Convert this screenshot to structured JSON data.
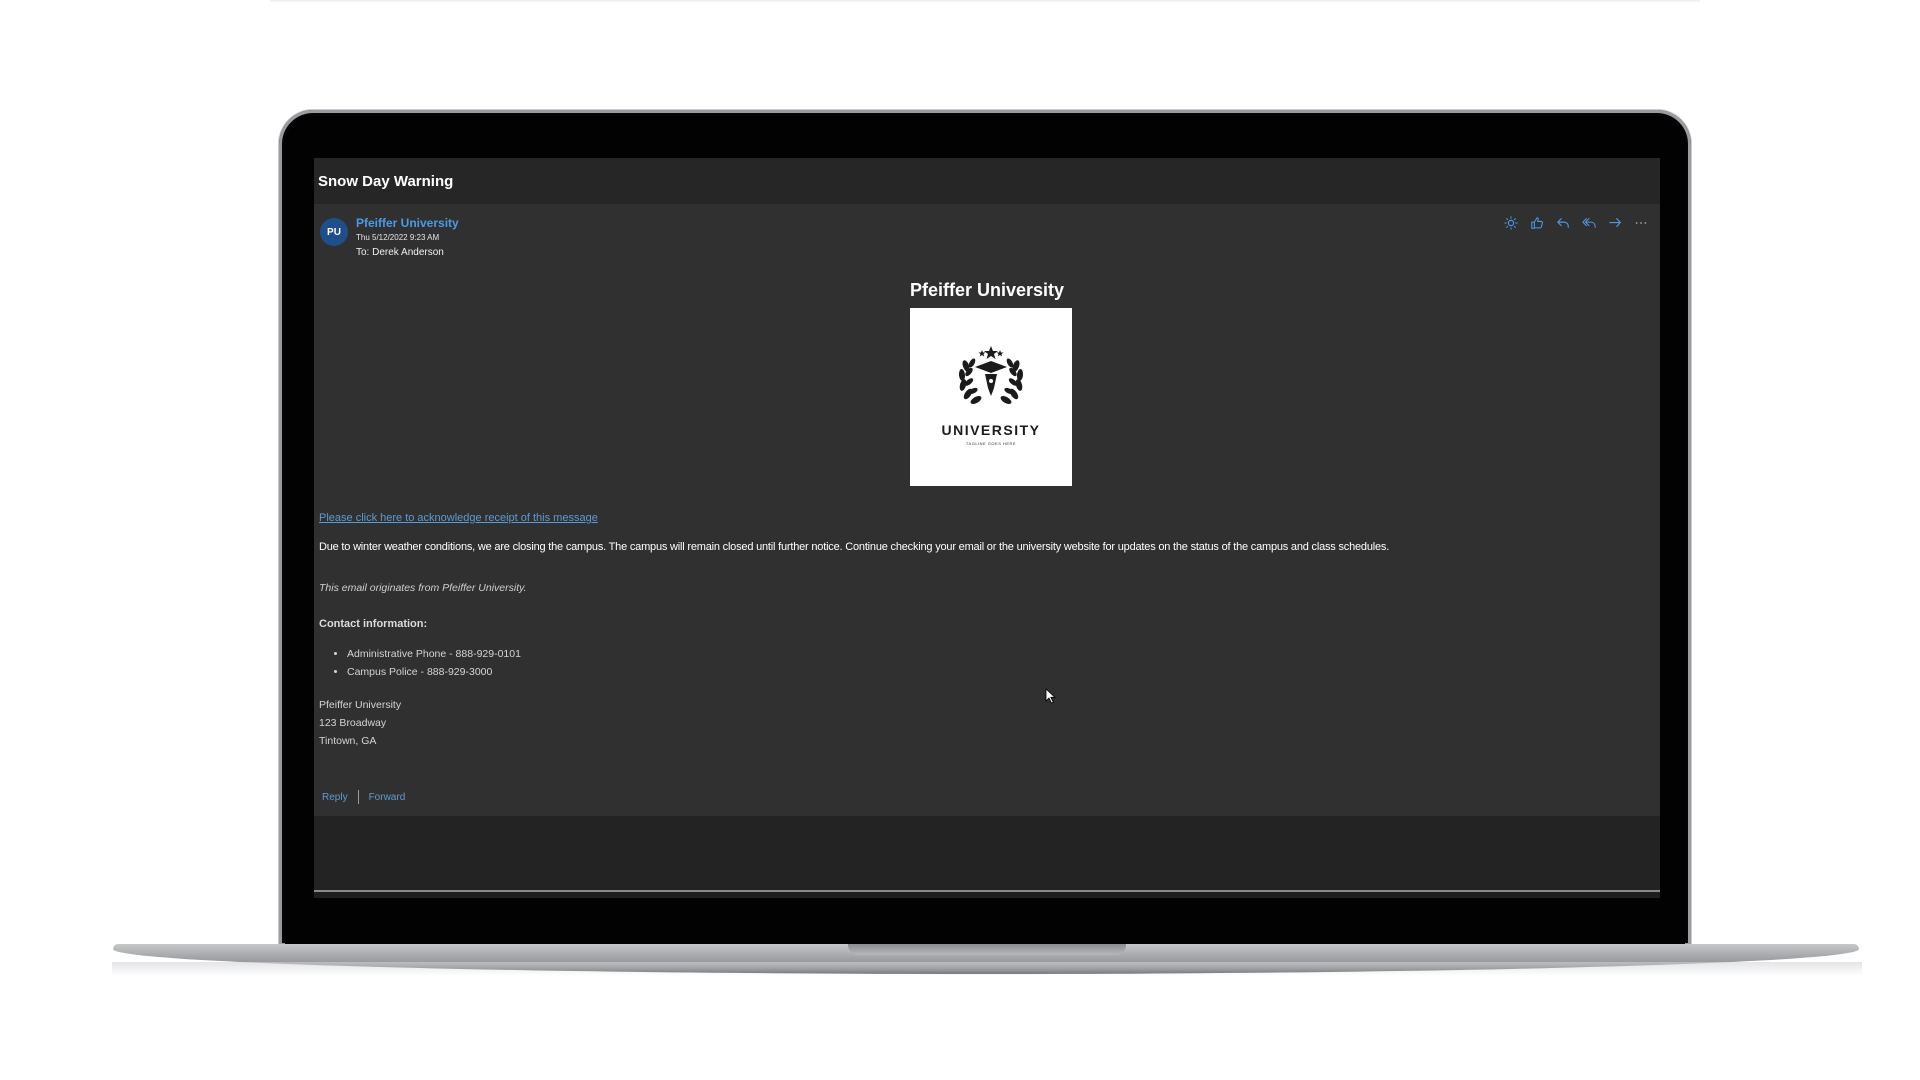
{
  "email": {
    "subject": "Snow Day Warning",
    "sender": {
      "initials": "PU",
      "name": "Pfeiffer University",
      "date": "Thu 5/12/2022 9:23 AM",
      "to": "To: Derek Anderson"
    },
    "actions": [
      {
        "name": "sun-icon",
        "label": "Brightness"
      },
      {
        "name": "like-icon",
        "label": "Like"
      },
      {
        "name": "reply-icon",
        "label": "Reply"
      },
      {
        "name": "reply-all-icon",
        "label": "Reply all"
      },
      {
        "name": "forward-icon",
        "label": "Forward"
      },
      {
        "name": "more-icon",
        "label": "More actions"
      }
    ],
    "org_title": "Pfeiffer University",
    "logo": {
      "word": "UNIVERSITY",
      "tagline": "TAGLINE GOES HERE"
    },
    "ack_link": "Please click here to acknowledge receipt of this message",
    "body": "Due to winter weather conditions, we are closing the campus. The campus will remain closed until further notice. Continue checking your email or the university website for updates on the status of the campus and class schedules.",
    "origin_note": "This email originates from Pfeiffer University.",
    "contact_heading": "Contact information:",
    "contacts": [
      "Administrative Phone - 888-929-0101",
      "Campus Police - 888-929-3000"
    ],
    "address": [
      "Pfeiffer University",
      "123 Broadway",
      "Tintown, GA"
    ],
    "reply_label": "Reply",
    "forward_label": "Forward"
  },
  "colors": {
    "link": "#5b9bd5",
    "sender_name": "#4a9ae6",
    "avatar": "#1f4f8a",
    "body_bg": "#303030",
    "header_bg": "#262626"
  }
}
